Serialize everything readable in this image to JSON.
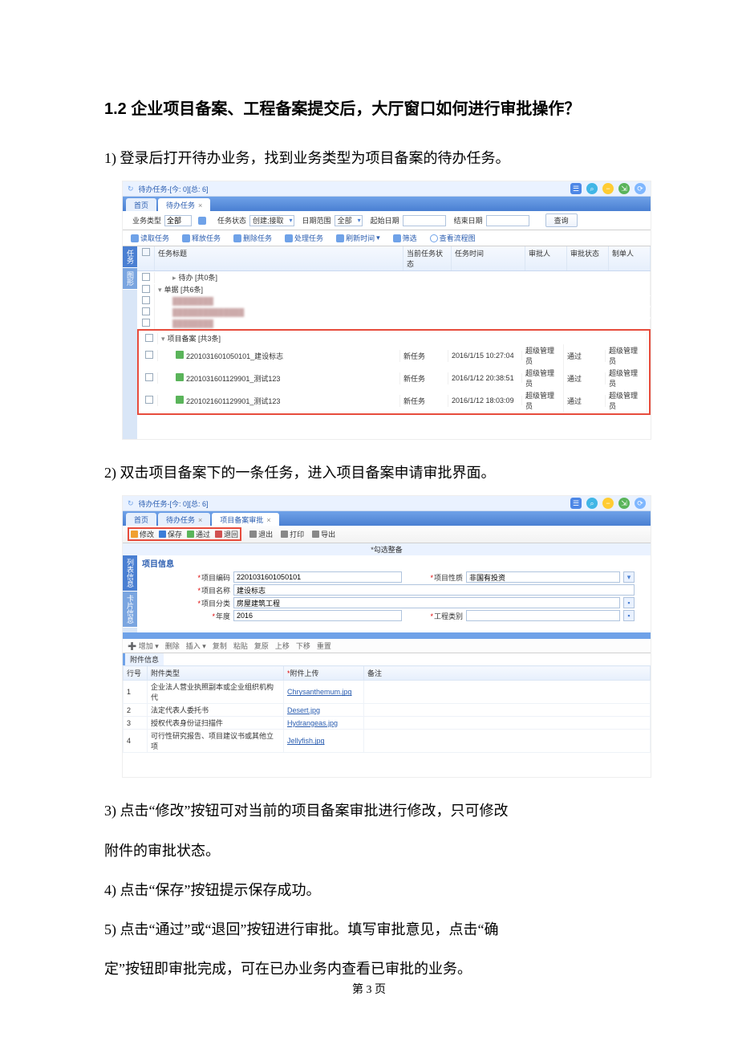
{
  "heading": "1.2 企业项目备案、工程备案提交后，大厅窗口如何进行审批操作？",
  "steps": {
    "s1": "1)  登录后打开待办业务，找到业务类型为项目备案的待办任务。",
    "s2": "2)  双击项目备案下的一条任务，进入项目备案申请审批界面。",
    "s3a": "3)  点击“修改”按钮可对当前的项目备案审批进行修改，只可修改",
    "s3b": "附件的审批状态。",
    "s4": "4)  点击“保存”按钮提示保存成功。",
    "s5a": "5)  点击“通过”或“退回”按钮进行审批。填写审批意见，点击“确",
    "s5b": "定”按钮即审批完成，可在已办业务内查看已审批的业务。"
  },
  "shot1": {
    "title": "待办任务-[今: 0][总: 6]",
    "tabs": {
      "home": "首页",
      "todo": "待办任务"
    },
    "filter": {
      "biztype_lbl": "业务类型",
      "biztype_val": "全部",
      "status_lbl": "任务状态",
      "status_val": "创建;接取",
      "daterange_lbl": "日期范围",
      "daterange_val": "全部",
      "start_lbl": "起始日期",
      "end_lbl": "结束日期",
      "query_btn": "查询"
    },
    "toolbar": {
      "a": "读取任务",
      "b": "释放任务",
      "c": "删除任务",
      "d": "处理任务",
      "e": "刷新时间",
      "f": "筛选",
      "g": "查看流程图"
    },
    "cols": {
      "title": "任务标题",
      "stat": "当前任务状态",
      "time": "任务时间",
      "aud": "审批人",
      "ast": "审批状态",
      "mk": "制单人"
    },
    "tree": {
      "g1": "待办 [共0条]",
      "g2": "单据 [共6条]",
      "g3": "项目备案 [共3条]"
    },
    "rows": [
      {
        "title": "2201031601050101_建设标志",
        "stat": "新任务",
        "time": "2016/1/15 10:27:04",
        "aud": "超级管理员",
        "ast": "通过",
        "mk": "超级管理员"
      },
      {
        "title": "2201031601129901_测试123",
        "stat": "新任务",
        "time": "2016/1/12 20:38:51",
        "aud": "超级管理员",
        "ast": "通过",
        "mk": "超级管理员"
      },
      {
        "title": "2201021601129901_测试123",
        "stat": "新任务",
        "time": "2016/1/12 18:03:09",
        "aud": "超级管理员",
        "ast": "通过",
        "mk": "超级管理员"
      }
    ],
    "sidetabs": {
      "a": "任务",
      "b": "图形"
    }
  },
  "shot2": {
    "title": "待办任务-[今: 0][总: 6]",
    "tabs": {
      "home": "首页",
      "todo": "待办任务",
      "approve": "项目备案审批"
    },
    "toolbar": {
      "edit": "修改",
      "save": "保存",
      "pass": "通过",
      "back": "退回",
      "quit": "退出",
      "print": "打印",
      "export": "导出"
    },
    "topcenter": "*勾选整备",
    "panel_title": "项目信息",
    "sidetabs": {
      "a": "列表信息",
      "b": "卡片信息"
    },
    "form": {
      "code_lbl": "项目编码",
      "code_val": "2201031601050101",
      "name_lbl": "项目名称",
      "name_val": "建设标志",
      "cls_lbl": "项目分类",
      "cls_val": "房屋建筑工程",
      "year_lbl": "年度",
      "year_val": "2016",
      "nature_lbl": "项目性质",
      "nature_val": "非国有投资",
      "engtype_lbl": "工程类别"
    },
    "atttoolbar": {
      "a": "增加",
      "b": "删除",
      "c": "插入",
      "d": "复制",
      "e": "粘贴",
      "f": "复原",
      "g": "上移",
      "h": "下移",
      "i": "重置"
    },
    "section": "附件信息",
    "atcols": {
      "no": "行号",
      "type": "附件类型",
      "upload": "附件上传",
      "note": "备注"
    },
    "atrows": [
      {
        "no": "1",
        "type": "企业法人营业执照副本或企业组织机构代",
        "link": "Chrysanthemum.jpg"
      },
      {
        "no": "2",
        "type": "法定代表人委托书",
        "link": "Desert.jpg"
      },
      {
        "no": "3",
        "type": "授权代表身份证扫描件",
        "link": "Hydrangeas.jpg"
      },
      {
        "no": "4",
        "type": "可行性研究报告、项目建议书或其他立项",
        "link": "Jellyfish.jpg"
      }
    ]
  },
  "footer": "第 3 页"
}
